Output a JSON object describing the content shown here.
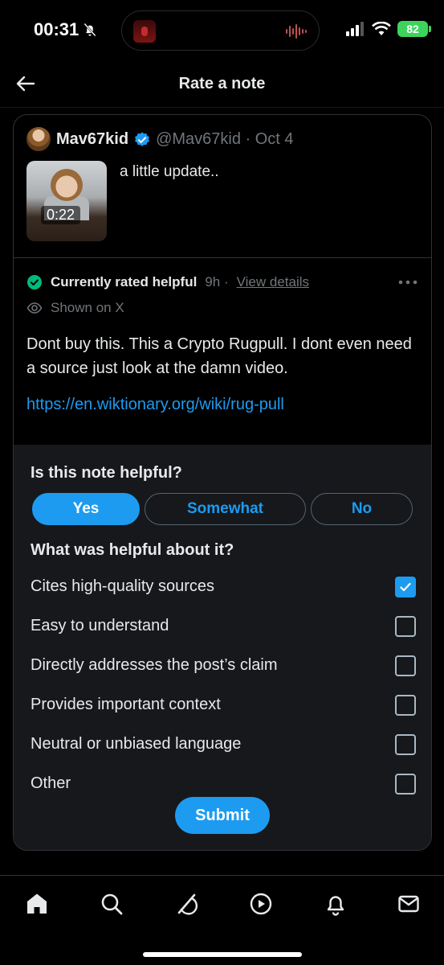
{
  "status_bar": {
    "time": "00:31",
    "battery": "82"
  },
  "header": {
    "title": "Rate a note"
  },
  "post": {
    "author_name": "Mav67kid",
    "handle_date": "@Mav67kid · Oct 4",
    "text": "a little update..",
    "video_duration": "0:22"
  },
  "note": {
    "status": "Currently rated helpful",
    "time": "9h ·",
    "view_details": "View details",
    "shown_on": "Shown on X",
    "body": "Dont buy this. This a Crypto Rugpull. I dont even need a source just look at the damn video.",
    "link": "https://en.wiktionary.org/wiki/rug-pull"
  },
  "rating": {
    "question": "Is this note helpful?",
    "options": [
      "Yes",
      "Somewhat",
      "No"
    ],
    "selected": "Yes",
    "helpful_question": "What was helpful about it?",
    "reasons": [
      {
        "label": "Cites high-quality sources",
        "checked": true
      },
      {
        "label": "Easy to understand",
        "checked": false
      },
      {
        "label": "Directly addresses the post’s claim",
        "checked": false
      },
      {
        "label": "Provides important context",
        "checked": false
      },
      {
        "label": "Neutral or unbiased language",
        "checked": false
      },
      {
        "label": "Other",
        "checked": false
      }
    ],
    "submit": "Submit"
  },
  "tab_bar": {
    "icons": [
      "home-icon",
      "search-icon",
      "grok-icon",
      "video-icon",
      "notifications-icon",
      "messages-icon"
    ]
  },
  "colors": {
    "accent": "#1d9bf0",
    "helpful_green": "#00ba7c",
    "battery_green": "#3dd45c"
  }
}
